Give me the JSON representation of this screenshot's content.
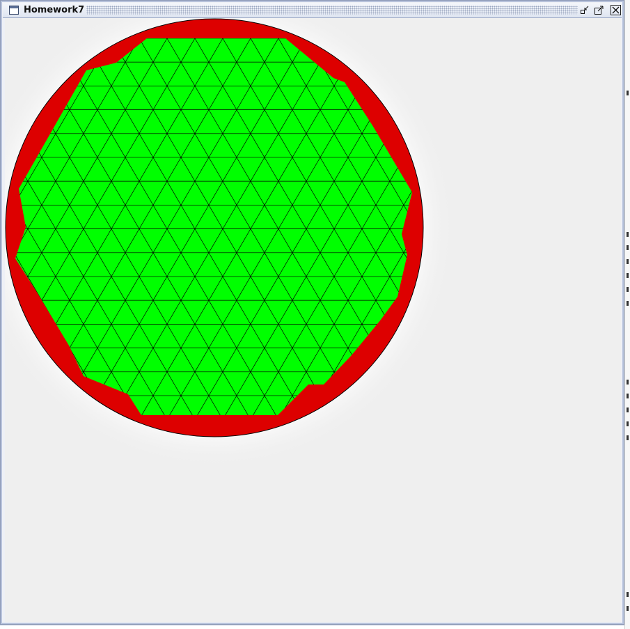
{
  "window": {
    "title": "Homework7",
    "buttons": {
      "minimize": "minimize-icon",
      "maximize": "maximize-icon",
      "close": "close-icon"
    }
  },
  "canvas": {
    "background": "#efefef",
    "circle_fill": "#dd0000",
    "circle_stroke": "#000000",
    "triangle_fill": "#00ff00",
    "triangle_stroke": "#000000"
  }
}
